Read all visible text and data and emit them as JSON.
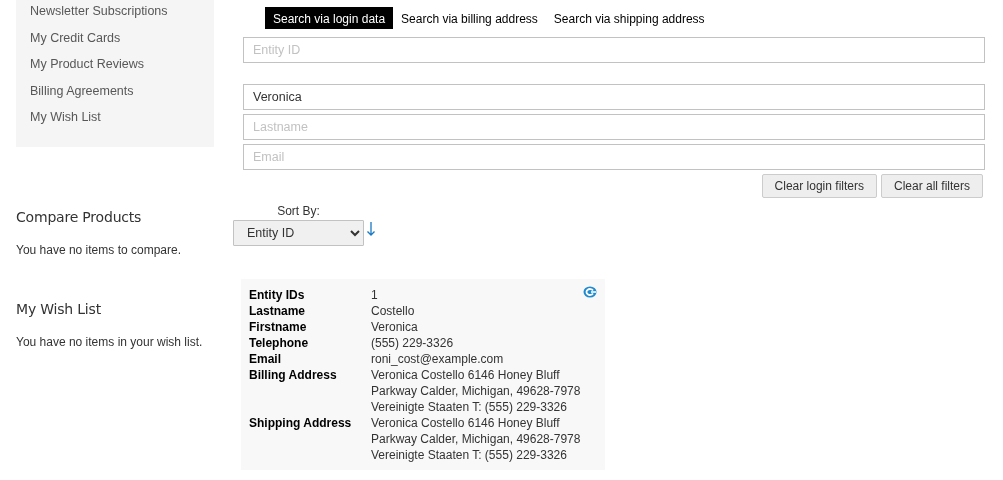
{
  "sidebar": {
    "items": [
      {
        "label": "Newsletter Subscriptions"
      },
      {
        "label": "My Credit Cards"
      },
      {
        "label": "My Product Reviews"
      },
      {
        "label": "Billing Agreements"
      },
      {
        "label": "My Wish List"
      }
    ]
  },
  "blocks": [
    {
      "title": "Compare Products",
      "text": "You have no items to compare."
    },
    {
      "title": "My Wish List",
      "text": "You have no items in your wish list."
    }
  ],
  "search": {
    "tabs": [
      {
        "label": "Search via login data",
        "selected": true
      },
      {
        "label": "Search via billing address",
        "selected": false
      },
      {
        "label": "Search via shipping address",
        "selected": false
      }
    ],
    "id_field": {
      "placeholder": "Entity ID"
    },
    "customer_fields": [
      {
        "value": "Veronica"
      },
      {
        "placeholder": "Lastname"
      },
      {
        "placeholder": "Email"
      }
    ],
    "buttons": [
      "Clear login filters",
      "Clear all filters"
    ]
  },
  "sort": {
    "label": "Sort By:",
    "value": "Entity ID",
    "descending": true
  },
  "result": {
    "rows": [
      {
        "label": "Entity IDs",
        "lines": [
          "1"
        ]
      },
      {
        "label": "Lastname",
        "lines": [
          "Costello"
        ]
      },
      {
        "label": "Firstname",
        "lines": [
          "Veronica"
        ]
      },
      {
        "label": "Telephone",
        "lines": [
          "(555) 229-3326"
        ]
      },
      {
        "label": "Email",
        "lines": [
          "roni_cost@example.com"
        ]
      },
      {
        "label": "Billing Address",
        "lines": [
          "Veronica Costello 6146 Honey Bluff",
          "Parkway Calder, Michigan, 49628-7978",
          "Vereinigte Staaten T: (555) 229-3326"
        ]
      },
      {
        "label": "Shipping Address",
        "lines": [
          "Veronica Costello 6146 Honey Bluff",
          "Parkway Calder, Michigan, 49628-7978",
          "Vereinigte Staaten T: (555) 229-3326"
        ]
      }
    ]
  }
}
